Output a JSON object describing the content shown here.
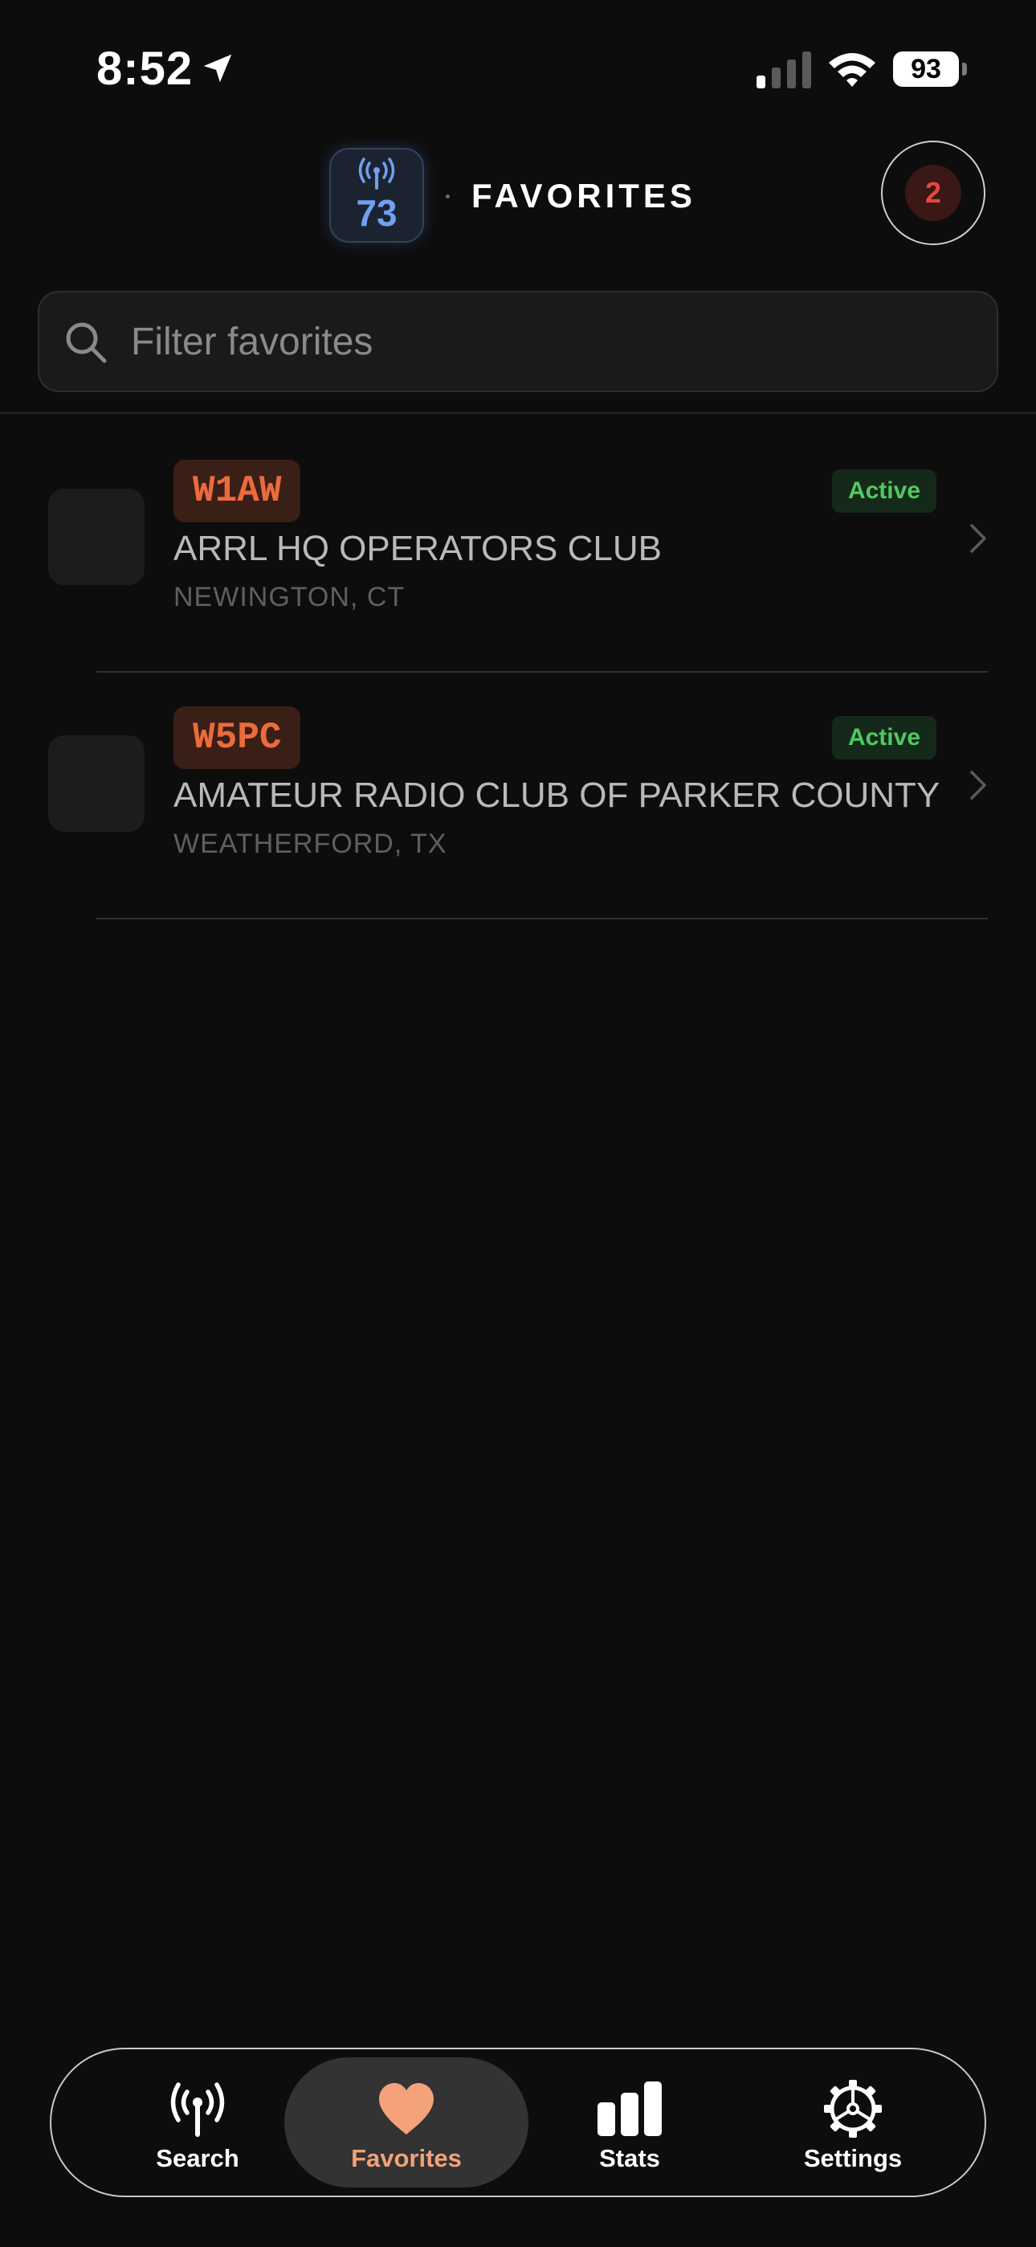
{
  "status_bar": {
    "time": "8:52",
    "battery": "93"
  },
  "header": {
    "logo_number": "73",
    "title": "FAVORITES",
    "count": "2"
  },
  "search": {
    "placeholder": "Filter favorites",
    "value": ""
  },
  "favorites": [
    {
      "callsign": "W1AW",
      "status": "Active",
      "name": "ARRL HQ OPERATORS CLUB",
      "location": "NEWINGTON, CT"
    },
    {
      "callsign": "W5PC",
      "status": "Active",
      "name": "AMATEUR RADIO CLUB OF PARKER COUNTY",
      "location": "WEATHERFORD, TX"
    }
  ],
  "tabs": [
    {
      "label": "Search",
      "icon": "antenna-icon"
    },
    {
      "label": "Favorites",
      "icon": "heart-icon"
    },
    {
      "label": "Stats",
      "icon": "bar-chart-icon"
    },
    {
      "label": "Settings",
      "icon": "gear-icon"
    }
  ],
  "colors": {
    "background": "#0d0d0d",
    "accent": "#f3a27a",
    "callsign": "#ec6b3c",
    "active": "#4fc960",
    "logo": "#6fa1f2",
    "badge": "#e5483b"
  }
}
